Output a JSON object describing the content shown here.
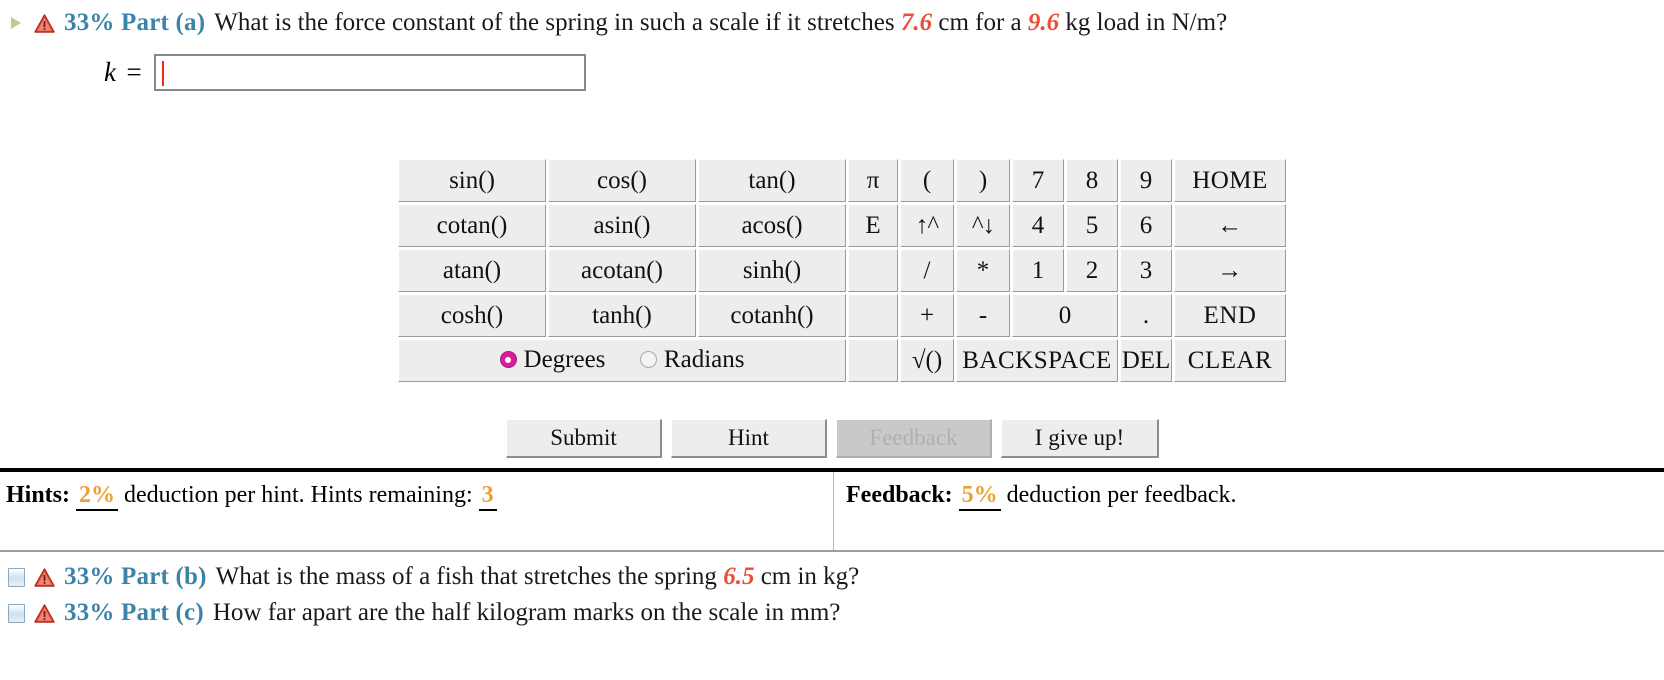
{
  "part_a": {
    "toggle_icon": "expand-triangle-icon",
    "warning_icon": "warning-triangle-icon",
    "label": "33% Part (a)",
    "text_before": "What is the force constant of the spring in such a scale if it stretches",
    "value_1": "7.6",
    "text_mid": "cm for a",
    "value_2": "9.6",
    "text_after": "kg load in N/m?"
  },
  "answer": {
    "label": "k =",
    "value": "",
    "placeholder": ""
  },
  "calculator": {
    "rows": [
      {
        "functions": [
          "sin()",
          "cos()",
          "tan()"
        ],
        "const": "π",
        "keys": [
          "(",
          ")",
          "7",
          "8",
          "9"
        ],
        "side": "HOME"
      },
      {
        "functions": [
          "cotan()",
          "asin()",
          "acos()"
        ],
        "const": "E",
        "keys": [
          "↑^",
          "^↓",
          "4",
          "5",
          "6"
        ],
        "side": "←"
      },
      {
        "functions": [
          "atan()",
          "acotan()",
          "sinh()"
        ],
        "const": "",
        "keys": [
          "/",
          "*",
          "1",
          "2",
          "3"
        ],
        "side": "→"
      },
      {
        "functions": [
          "cosh()",
          "tanh()",
          "cotanh()"
        ],
        "const": "",
        "keys": [
          "+",
          "-",
          "0",
          "."
        ],
        "side": "END"
      }
    ],
    "bottom": {
      "sqrt": "√()",
      "backspace": "BACKSPACE",
      "del": "DEL",
      "clear": "CLEAR"
    },
    "angle_mode": {
      "degrees_label": "Degrees",
      "radians_label": "Radians",
      "selected": "Degrees",
      "selected_color": "#d51e9a"
    },
    "disabled_keys": [
      ")",
      "↑^",
      "^↓",
      "/",
      "*",
      "HOME",
      "←",
      "→",
      "END",
      "BACKSPACE",
      "DEL",
      "CLEAR"
    ]
  },
  "actions": {
    "submit": "Submit",
    "hint": "Hint",
    "feedback": "Feedback",
    "give_up": "I give up!"
  },
  "hints_bar": {
    "hints_title": "Hints:",
    "hints_pct": "2%",
    "hints_text": "deduction per hint. Hints remaining:",
    "hints_remaining": "3",
    "feedback_title": "Feedback:",
    "feedback_pct": "5%",
    "feedback_text": "deduction per feedback."
  },
  "part_b": {
    "toggle_icon": "collapse-square-icon",
    "warning_icon": "warning-triangle-icon",
    "label": "33% Part (b)",
    "text_before": "What is the mass of a fish that stretches the spring",
    "value": "6.5",
    "text_after": "cm in kg?"
  },
  "part_c": {
    "toggle_icon": "collapse-square-icon",
    "warning_icon": "warning-triangle-icon",
    "label": "33% Part (c)",
    "text": "How far apart are the half kilogram marks on the scale in mm?"
  },
  "colors": {
    "part_label": "#3b84a8",
    "value_highlight": "#e8503a",
    "pct_highlight": "#f0a030",
    "radio_selected": "#d51e9a",
    "caret": "#ee2b14"
  }
}
